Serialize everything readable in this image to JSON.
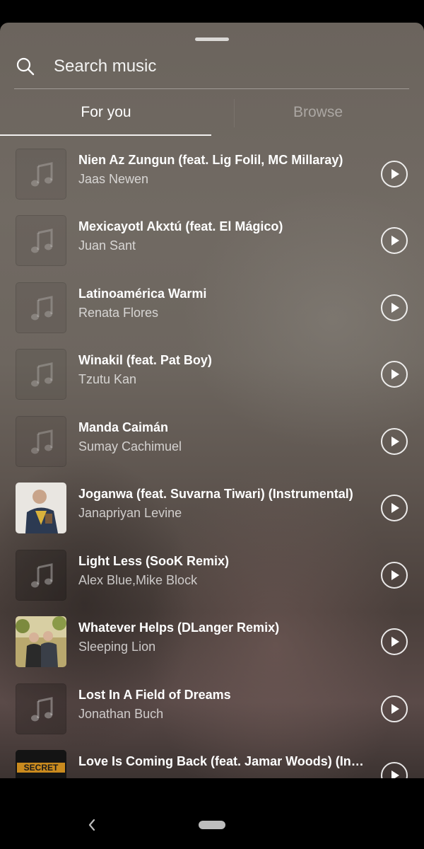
{
  "search": {
    "placeholder": "Search music"
  },
  "tabs": [
    {
      "label": "For you",
      "active": true
    },
    {
      "label": "Browse",
      "active": false
    }
  ],
  "tracks": [
    {
      "title": "Nien Az Zungun (feat. Lig Folil, MC Millaray)",
      "artist": "Jaas Newen",
      "art": "placeholder-note-icon"
    },
    {
      "title": "Mexicayotl Akxtú (feat. El Mágico)",
      "artist": "Juan Sant",
      "art": "placeholder-note-icon"
    },
    {
      "title": "Latinoamérica Warmi",
      "artist": "Renata Flores",
      "art": "placeholder-note-icon"
    },
    {
      "title": "Winakil (feat. Pat Boy)",
      "artist": "Tzutu Kan",
      "art": "placeholder-note-icon"
    },
    {
      "title": "Manda Caimán",
      "artist": "Sumay Cachimuel",
      "art": "placeholder-note-icon"
    },
    {
      "title": "Joganwa (feat. Suvarna Tiwari) (Instrumental)",
      "artist": "Janapriyan Levine",
      "art": "album-photo"
    },
    {
      "title": "Light Less (SooK Remix)",
      "artist": "Alex Blue,Mike Block",
      "art": "placeholder-note-icon"
    },
    {
      "title": "Whatever Helps (DLanger Remix)",
      "artist": "Sleeping Lion",
      "art": "album-photo"
    },
    {
      "title": "Lost In A Field of Dreams",
      "artist": "Jonathan Buch",
      "art": "placeholder-note-icon"
    },
    {
      "title": "Love Is Coming Back (feat. Jamar Woods) (Instrumental)",
      "artist": "",
      "art": "album-photo",
      "art_text": "SECRET"
    }
  ],
  "icons": {
    "search": "search-icon",
    "play": "play-icon",
    "nav_back": "chevron-left-icon",
    "nav_home": "home-pill-icon"
  },
  "colors": {
    "accent_text": "#ffffff",
    "muted_text": "#b9b4ae",
    "sheet_top": "#6b645d",
    "sheet_bottom": "#3c3331"
  }
}
